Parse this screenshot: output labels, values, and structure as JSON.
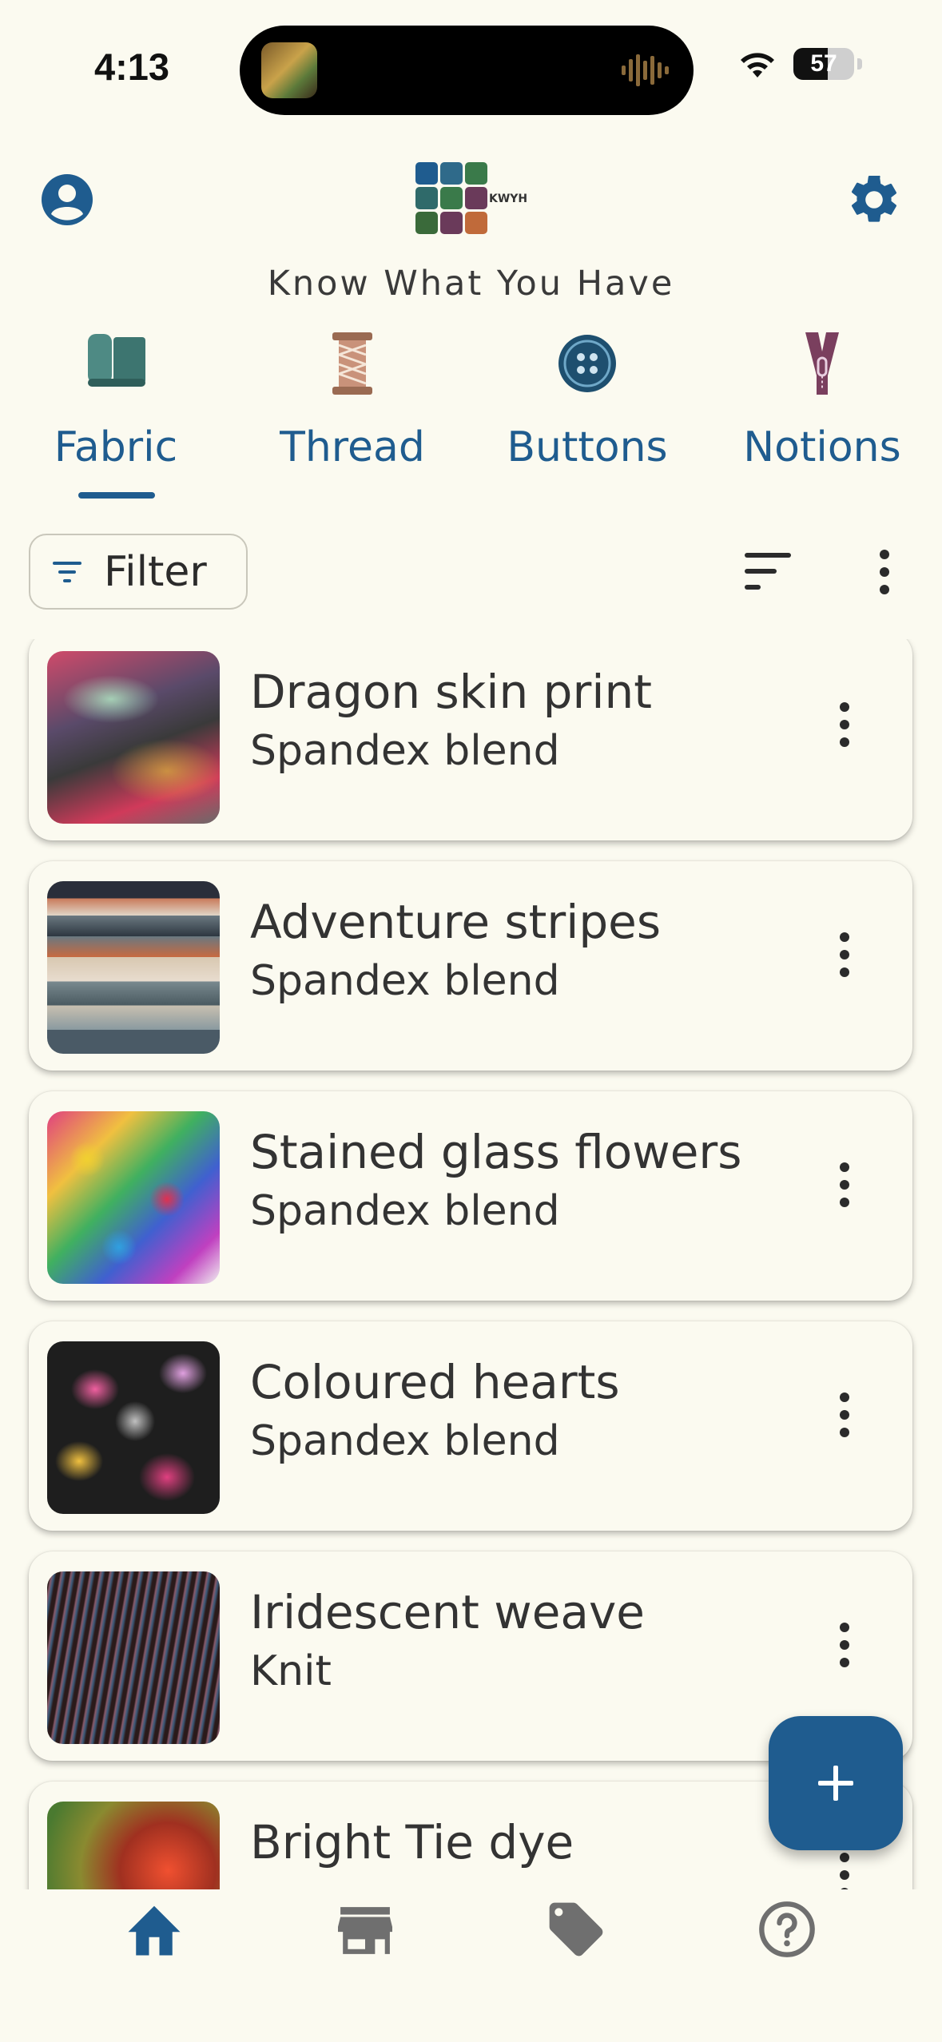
{
  "status_bar": {
    "time": "4:13",
    "battery": "57"
  },
  "header": {
    "logo_text": "KWYH",
    "title": "Know What You Have"
  },
  "tabs": [
    {
      "label": "Fabric",
      "icon": "fabric-bolt-icon",
      "selected": true
    },
    {
      "label": "Thread",
      "icon": "thread-spool-icon",
      "selected": false
    },
    {
      "label": "Buttons",
      "icon": "button-icon",
      "selected": false
    },
    {
      "label": "Notions",
      "icon": "zipper-icon",
      "selected": false
    }
  ],
  "toolbar": {
    "filter_label": "Filter"
  },
  "items": [
    {
      "title": "Dragon skin print",
      "subtitle": "Spandex blend"
    },
    {
      "title": "Adventure stripes",
      "subtitle": "Spandex blend"
    },
    {
      "title": "Stained glass flowers",
      "subtitle": "Spandex blend"
    },
    {
      "title": "Coloured hearts",
      "subtitle": "Spandex blend"
    },
    {
      "title": "Iridescent weave",
      "subtitle": "Knit"
    },
    {
      "title": "Bright Tie dye",
      "subtitle": ""
    }
  ],
  "bottom_nav": [
    {
      "icon": "home-icon",
      "active": true
    },
    {
      "icon": "store-icon",
      "active": false
    },
    {
      "icon": "tag-icon",
      "active": false
    },
    {
      "icon": "help-icon",
      "active": false
    }
  ],
  "colors": {
    "primary": "#1f5c8f",
    "background": "#fbfaf0",
    "inactive": "#6f6f6f"
  }
}
